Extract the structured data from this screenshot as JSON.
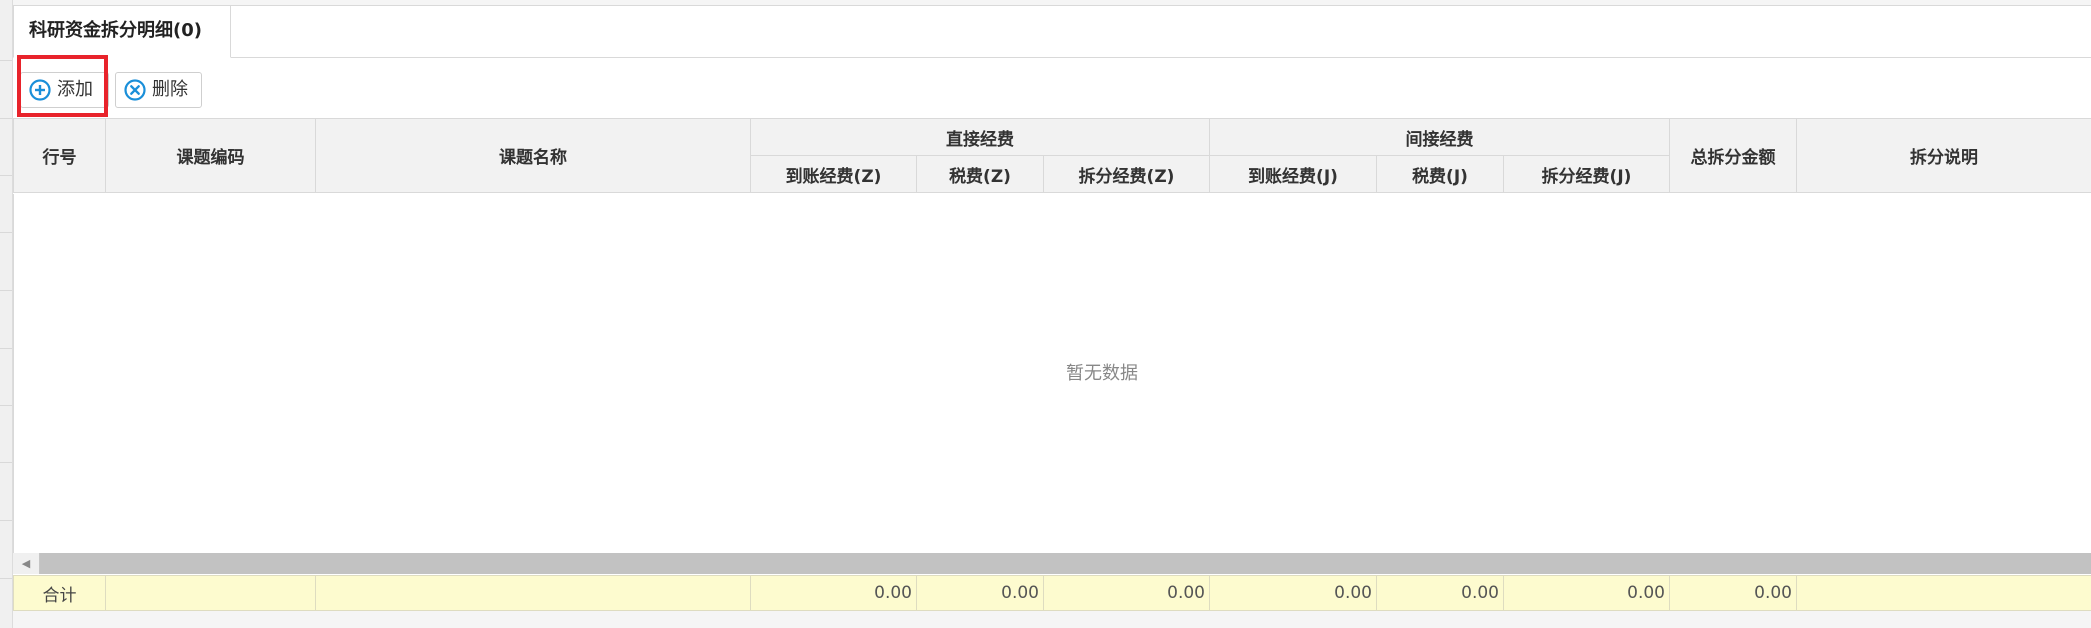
{
  "tab": {
    "title": "科研资金拆分明细(0)"
  },
  "toolbar": {
    "add_label": "添加",
    "delete_label": "删除"
  },
  "table": {
    "headers": {
      "row_no": "行号",
      "subject_code": "课题编码",
      "subject_name": "课题名称",
      "direct_group": "直接经费",
      "direct_received": "到账经费(Z)",
      "direct_tax": "税费(Z)",
      "direct_split": "拆分经费(Z)",
      "indirect_group": "间接经费",
      "indirect_received": "到账经费(J)",
      "indirect_tax": "税费(J)",
      "indirect_split": "拆分经费(J)",
      "total_split": "总拆分金额",
      "split_note": "拆分说明"
    },
    "empty_text": "暂无数据",
    "footer": {
      "label": "合计",
      "direct_received": "0.00",
      "direct_tax": "0.00",
      "direct_split": "0.00",
      "indirect_received": "0.00",
      "indirect_tax": "0.00",
      "indirect_split": "0.00",
      "total_split": "0.00"
    }
  },
  "colors": {
    "highlight": "#e8232b",
    "icon_blue": "#1a8fd9",
    "footer_bg": "#fdfbcf",
    "header_bg": "#f2f2f2"
  },
  "icons": {
    "add": "plus-circle-icon",
    "delete": "x-circle-icon"
  }
}
